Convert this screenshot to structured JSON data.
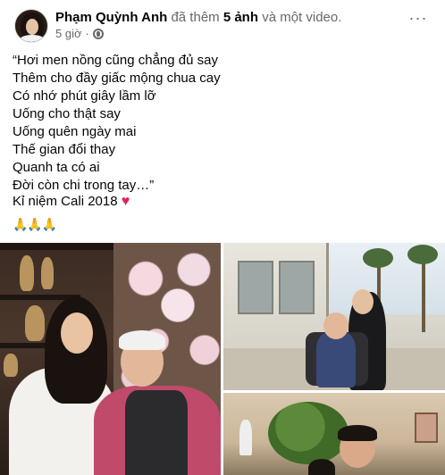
{
  "post": {
    "author": "Phạm Quỳnh Anh",
    "action_prefix": "đã thêm",
    "action_count": "5 ảnh",
    "action_suffix": "và một video.",
    "time": "5 giờ",
    "separator": "·",
    "privacy_icon": "globe-icon",
    "more_label": "···"
  },
  "content": {
    "lines": [
      "“Hơi men nồng cũng chẳng đủ say",
      "Thêm cho đầy giấc mộng chua cay",
      "Có nhớ phút giây lầm lỡ",
      "Uống cho thật say",
      "Uống quên ngày mai",
      "Thế gian đổi thay",
      "Quanh ta có ai",
      "Đời còn chi trong tay…”"
    ],
    "memory": "Kỉ niệm Cali 2018",
    "heart": "♥",
    "pray": "🙏🙏🙏"
  },
  "colors": {
    "text": "#050505",
    "secondary": "#65676b",
    "heart": "#e0245e"
  }
}
